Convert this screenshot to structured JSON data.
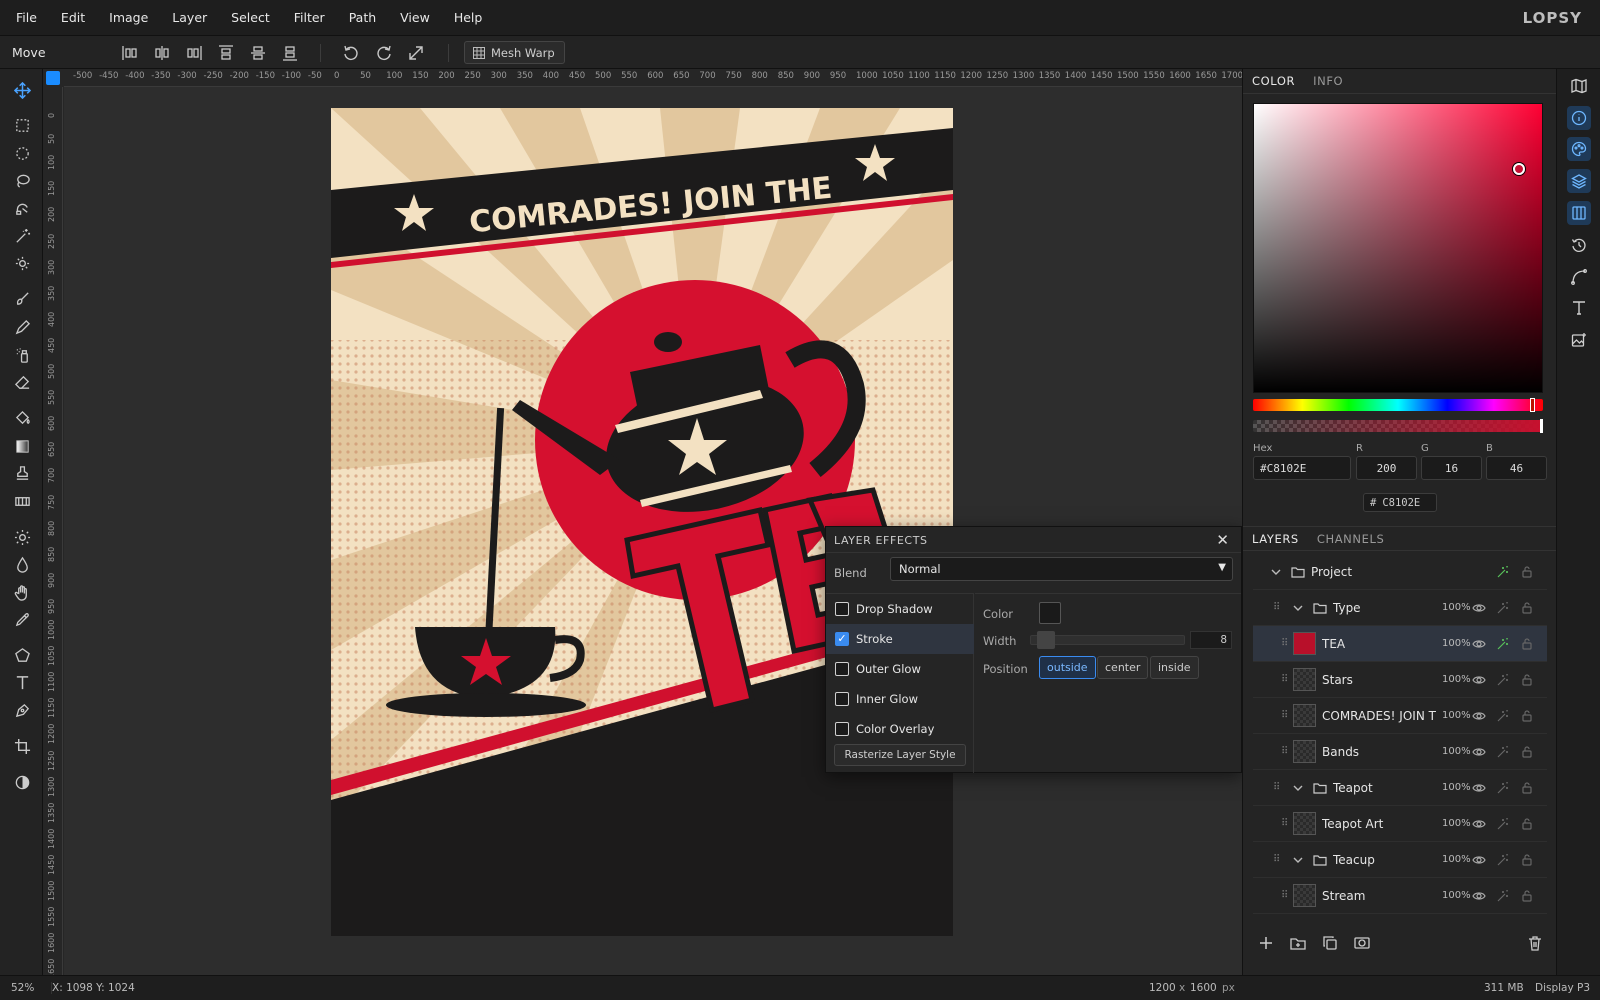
{
  "brand": "LOPSY",
  "menu": [
    "File",
    "Edit",
    "Image",
    "Layer",
    "Select",
    "Filter",
    "Path",
    "View",
    "Help"
  ],
  "options": {
    "tool_name": "Move",
    "mesh_warp_label": "Mesh Warp"
  },
  "ruler": {
    "top": [
      "-500",
      "-450",
      "-400",
      "-350",
      "-300",
      "-250",
      "-200",
      "-150",
      "-100",
      "-50",
      "0",
      "50",
      "100",
      "150",
      "200",
      "250",
      "300",
      "350",
      "400",
      "450",
      "500",
      "550",
      "600",
      "650",
      "700",
      "750",
      "800",
      "850",
      "900",
      "950",
      "1000",
      "1050",
      "1100",
      "1150",
      "1200",
      "1250",
      "1300",
      "1350",
      "1400",
      "1450",
      "1500",
      "1550",
      "1600",
      "1650",
      "1700"
    ],
    "left": [
      "0",
      "50",
      "100",
      "150",
      "200",
      "250",
      "300",
      "350",
      "400",
      "450",
      "500",
      "550",
      "600",
      "650",
      "700",
      "750",
      "800",
      "850",
      "900",
      "950",
      "1000",
      "1050",
      "1100",
      "1150",
      "1200",
      "1250",
      "1300",
      "1350",
      "1400",
      "1450",
      "1500",
      "1550",
      "1600",
      "1650"
    ]
  },
  "poster": {
    "headline": "COMRADES! JOIN THE",
    "big_word": "TEA"
  },
  "color_panel": {
    "tabs": [
      "COLOR",
      "INFO"
    ],
    "hex_label": "Hex",
    "r_label": "R",
    "g_label": "G",
    "b_label": "B",
    "hex": "#C8102E",
    "r": "200",
    "g": "16",
    "b": "46",
    "chip_hash": "#",
    "chip_hex": "C8102E",
    "color": "#C8102E"
  },
  "layers_panel": {
    "tabs": [
      "LAYERS",
      "CHANNELS"
    ],
    "rows": [
      {
        "name": "Project",
        "type": "group",
        "level": 0,
        "opacity": ""
      },
      {
        "name": "Type",
        "type": "group",
        "level": 1,
        "opacity": "100%"
      },
      {
        "name": "TEA",
        "type": "layer",
        "level": 2,
        "opacity": "100%",
        "selected": true,
        "fx": true
      },
      {
        "name": "Stars",
        "type": "layer",
        "level": 2,
        "opacity": "100%"
      },
      {
        "name": "COMRADES! JOIN T",
        "type": "layer",
        "level": 2,
        "opacity": "100%"
      },
      {
        "name": "Bands",
        "type": "layer",
        "level": 2,
        "opacity": "100%"
      },
      {
        "name": "Teapot",
        "type": "group",
        "level": 1,
        "opacity": "100%"
      },
      {
        "name": "Teapot Art",
        "type": "layer",
        "level": 2,
        "opacity": "100%"
      },
      {
        "name": "Teacup",
        "type": "group",
        "level": 1,
        "opacity": "100%"
      },
      {
        "name": "Stream",
        "type": "layer",
        "level": 2,
        "opacity": "100%"
      }
    ]
  },
  "layer_effects": {
    "title": "LAYER EFFECTS",
    "blend_label": "Blend",
    "blend_value": "Normal",
    "effects": [
      {
        "label": "Drop Shadow",
        "checked": false
      },
      {
        "label": "Stroke",
        "checked": true
      },
      {
        "label": "Outer Glow",
        "checked": false
      },
      {
        "label": "Inner Glow",
        "checked": false
      },
      {
        "label": "Color Overlay",
        "checked": false
      }
    ],
    "rasterize_label": "Rasterize Layer Style",
    "stroke": {
      "color_label": "Color",
      "width_label": "Width",
      "width_value": "8",
      "position_label": "Position",
      "positions": [
        "outside",
        "center",
        "inside"
      ],
      "selected_position": "outside"
    }
  },
  "status": {
    "zoom": "52%",
    "coords": "X: 1098  Y: 1024",
    "doc_w": "1200",
    "doc_x": "x",
    "doc_h": "1600",
    "doc_unit": "px",
    "memory": "311 MB",
    "profile": "Display P3"
  }
}
